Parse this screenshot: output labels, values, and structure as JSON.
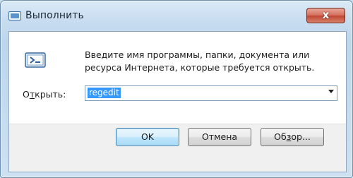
{
  "window": {
    "title": "Выполнить",
    "close_glyph": "x"
  },
  "dialog": {
    "prompt": "Введите имя программы, папки, документа или ресурса Интернета, которые требуется открыть.",
    "open_label_prefix": "О",
    "open_label_accel": "т",
    "open_label_suffix": "крыть:",
    "command_value": "regedit"
  },
  "buttons": {
    "ok": "OK",
    "cancel": "Отмена",
    "browse_prefix": "Об",
    "browse_accel": "з",
    "browse_suffix": "ор..."
  },
  "icons": {
    "window": "run-window-icon",
    "dialog": "run-program-icon",
    "dropdown": "chevron-down-icon"
  },
  "colors": {
    "selection": "#3399ff",
    "close_button": "#c9513d",
    "default_button_border": "#3c7fb1"
  }
}
